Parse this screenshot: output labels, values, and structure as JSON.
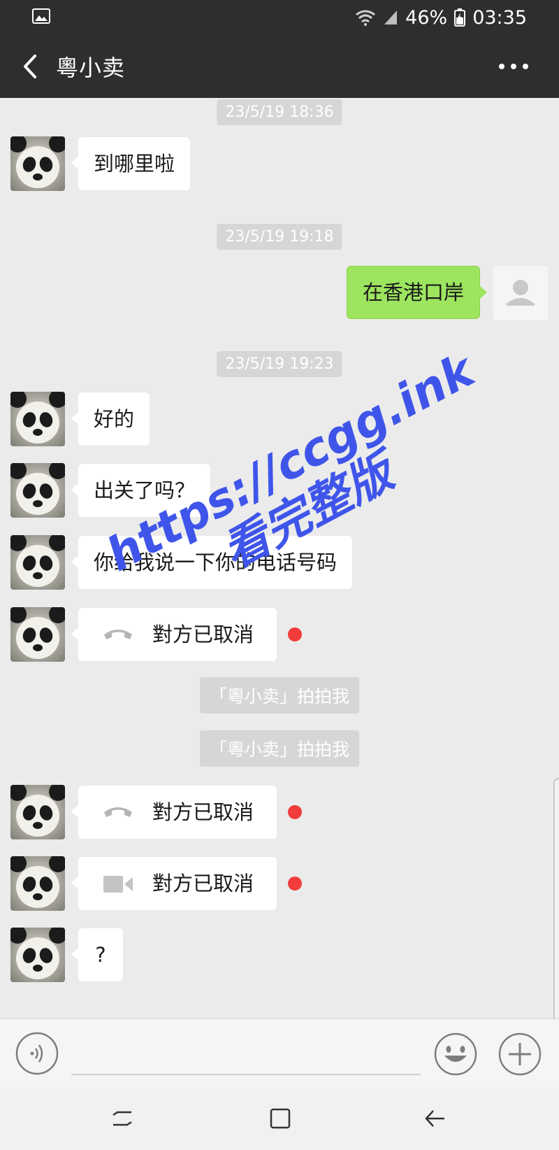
{
  "status_bar": {
    "battery": "46%",
    "time": "03:35",
    "icons": [
      "image-icon",
      "wifi-icon",
      "signal-icon",
      "battery-icon"
    ]
  },
  "header": {
    "title": "粵小卖",
    "back_icon": "chevron-left-icon",
    "more_icon": "more-dots-icon"
  },
  "messages": {
    "ts1": "23/5/19 18:36",
    "m1": "到哪里啦",
    "ts2": "23/5/19 19:18",
    "m2": "在香港口岸",
    "ts3": "23/5/19 19:23",
    "m3": "好的",
    "m4": "出关了吗？",
    "m5": "你给我说一下你的电话号码",
    "m6": "對方已取消",
    "sys1": "「粵小卖」拍拍我",
    "sys2": "「粵小卖」拍拍我",
    "m7": "對方已取消",
    "m8": "對方已取消",
    "m9": "?"
  },
  "watermark": {
    "line1": "https://ccgg.ink",
    "line2": "看完整版"
  },
  "input_bar": {
    "voice_icon": "voice-icon",
    "emoji_icon": "emoji-icon",
    "plus_icon": "plus-icon"
  },
  "nav_bar": {
    "icons": [
      "recent-apps-icon",
      "home-icon",
      "back-icon"
    ]
  },
  "colors": {
    "header_bg": "#2e2e2e",
    "chat_bg": "#ebebeb",
    "outgoing_bubble": "#9de55f",
    "incoming_bubble": "#ffffff",
    "unread_dot": "#f23c3c",
    "watermark": "#3f55ea"
  }
}
